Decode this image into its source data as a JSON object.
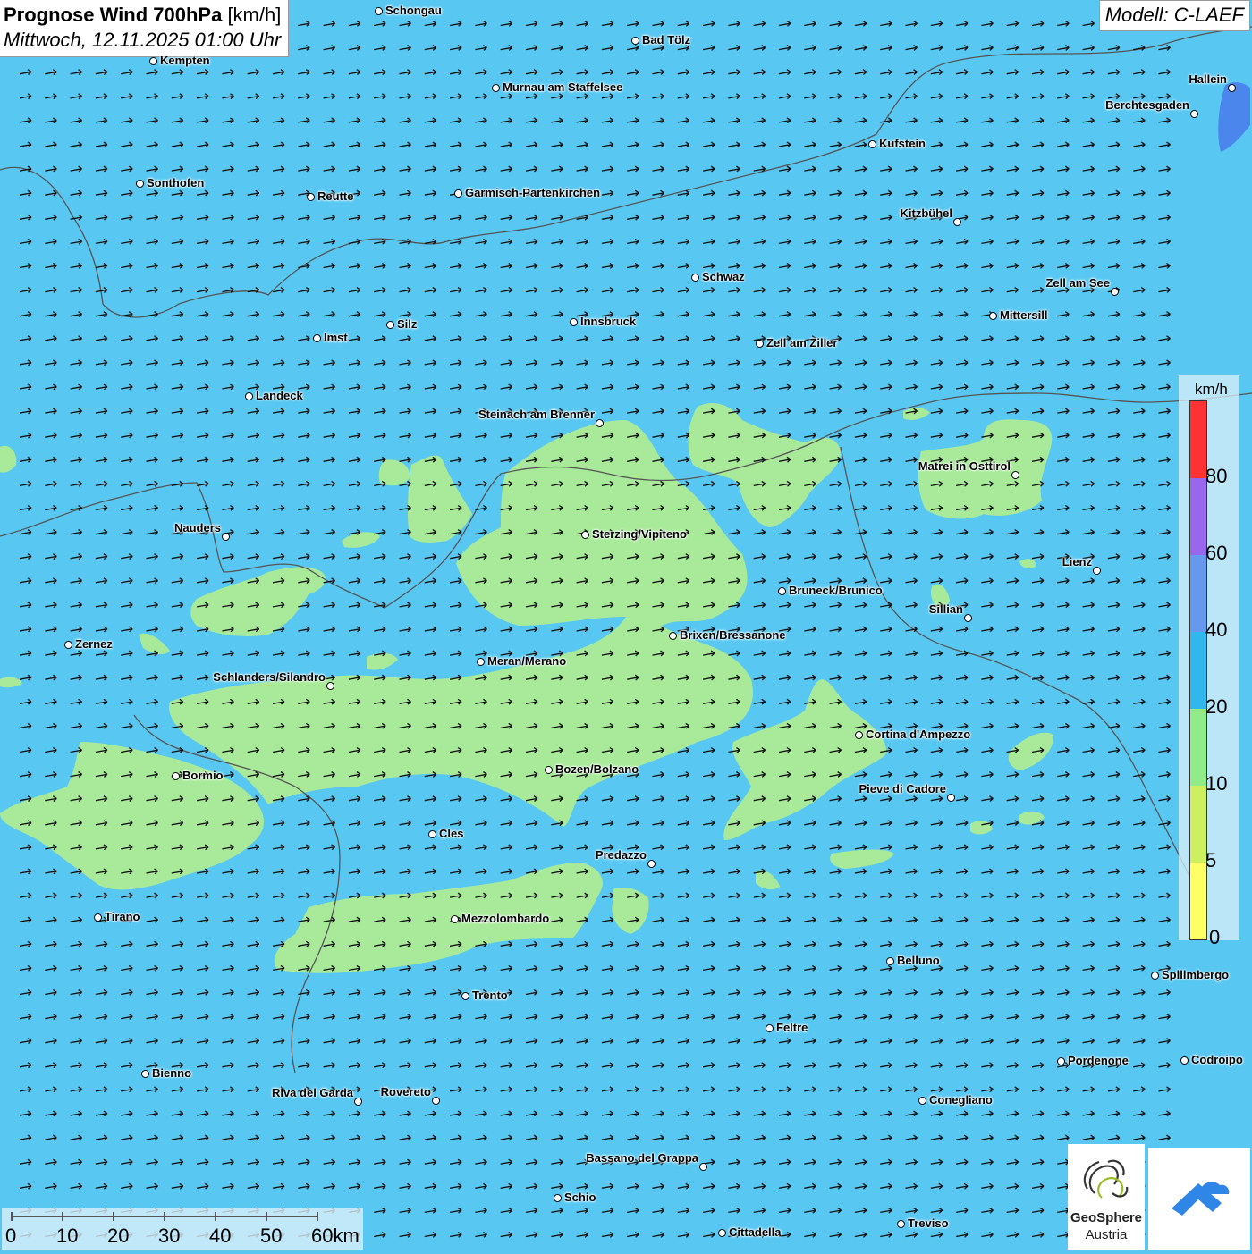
{
  "header": {
    "title_bold": "Prognose Wind 700hPa",
    "title_unit": "[km/h]",
    "datetime": "Mittwoch, 12.11.2025 01:00 Uhr",
    "model": "Modell: C-LAEF"
  },
  "legend": {
    "unit": "km/h",
    "ticks": [
      "0",
      "5",
      "10",
      "20",
      "40",
      "60",
      "80"
    ],
    "colors": [
      "#ffff66",
      "#ccf060",
      "#90ec88",
      "#30b8ee",
      "#6699ee",
      "#9966ee",
      "#ff3333"
    ]
  },
  "scale_bar": {
    "labels": [
      "0",
      "10",
      "20",
      "30",
      "40",
      "50",
      "60km"
    ]
  },
  "logo": {
    "name": "GeoSphere",
    "sub": "Austria"
  },
  "colors": {
    "background_wind": "#58c8f2",
    "calm_zone": "#a8ea9a",
    "high_wind": "#4a86ec",
    "arrow": "#111111"
  },
  "cities": [
    {
      "name": "Schongau"
    },
    {
      "name": "Bad Tölz"
    },
    {
      "name": "Kempten"
    },
    {
      "name": "Murnau am Staffelsee"
    },
    {
      "name": "Hallein"
    },
    {
      "name": "Berchtesgaden"
    },
    {
      "name": "Kufstein"
    },
    {
      "name": "Sonthofen"
    },
    {
      "name": "Reutte"
    },
    {
      "name": "Garmisch-Partenkirchen"
    },
    {
      "name": "Kitzbühel"
    },
    {
      "name": "Schwaz"
    },
    {
      "name": "Zell am See"
    },
    {
      "name": "Mittersill"
    },
    {
      "name": "Silz"
    },
    {
      "name": "Innsbruck"
    },
    {
      "name": "Imst"
    },
    {
      "name": "Zell am Ziller"
    },
    {
      "name": "Landeck"
    },
    {
      "name": "Steinach am Brenner"
    },
    {
      "name": "Matrei in Osttirol"
    },
    {
      "name": "Nauders"
    },
    {
      "name": "Sterzing/Vipiteno"
    },
    {
      "name": "Lienz"
    },
    {
      "name": "Bruneck/Brunico"
    },
    {
      "name": "Sillian"
    },
    {
      "name": "Zernez"
    },
    {
      "name": "Brixen/Bressanone"
    },
    {
      "name": "Meran/Merano"
    },
    {
      "name": "Schlanders/Silandro"
    },
    {
      "name": "Cortina d'Ampezzo"
    },
    {
      "name": "Bormio"
    },
    {
      "name": "Bozen/Bolzano"
    },
    {
      "name": "Pieve di Cadore"
    },
    {
      "name": "Cles"
    },
    {
      "name": "Predazzo"
    },
    {
      "name": "Tirano"
    },
    {
      "name": "Mezzolombardo"
    },
    {
      "name": "Belluno"
    },
    {
      "name": "Spilimbergo"
    },
    {
      "name": "Trento"
    },
    {
      "name": "Feltre"
    },
    {
      "name": "Pordenone"
    },
    {
      "name": "Codroipo"
    },
    {
      "name": "Bienno"
    },
    {
      "name": "Riva del Garda"
    },
    {
      "name": "Rovereto"
    },
    {
      "name": "Conegliano"
    },
    {
      "name": "Bassano del Grappa"
    },
    {
      "name": "Schio"
    },
    {
      "name": "Treviso"
    },
    {
      "name": "Cittadella"
    }
  ]
}
